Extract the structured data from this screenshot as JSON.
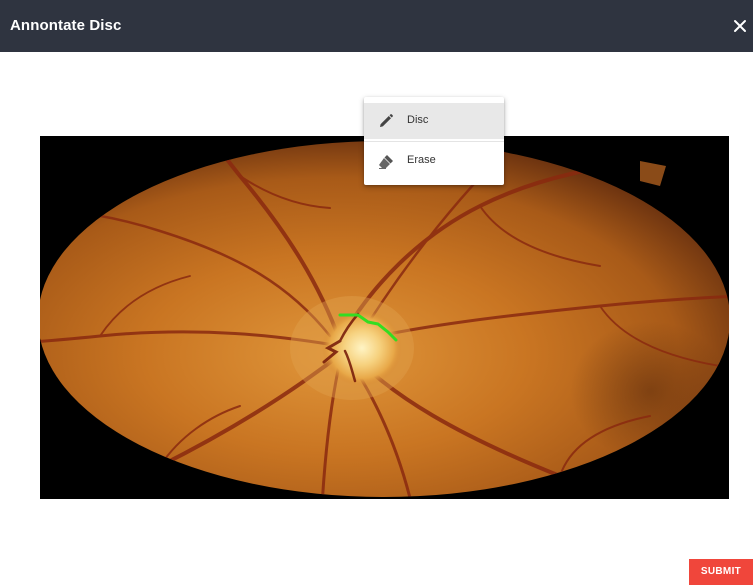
{
  "dialog": {
    "title": "Annontate Disc",
    "close_icon": "close-icon"
  },
  "tool_menu": {
    "items": [
      {
        "label": "Disc",
        "icon": "pencil-icon",
        "selected": true
      },
      {
        "label": "Erase",
        "icon": "eraser-icon",
        "selected": false
      }
    ]
  },
  "annotation": {
    "stroke_color": "#33dd22"
  },
  "actions": {
    "submit_label": "SUBMIT",
    "submit_color": "#f0463b"
  },
  "colors": {
    "titlebar": "#2f3440",
    "image_background": "#000000"
  }
}
